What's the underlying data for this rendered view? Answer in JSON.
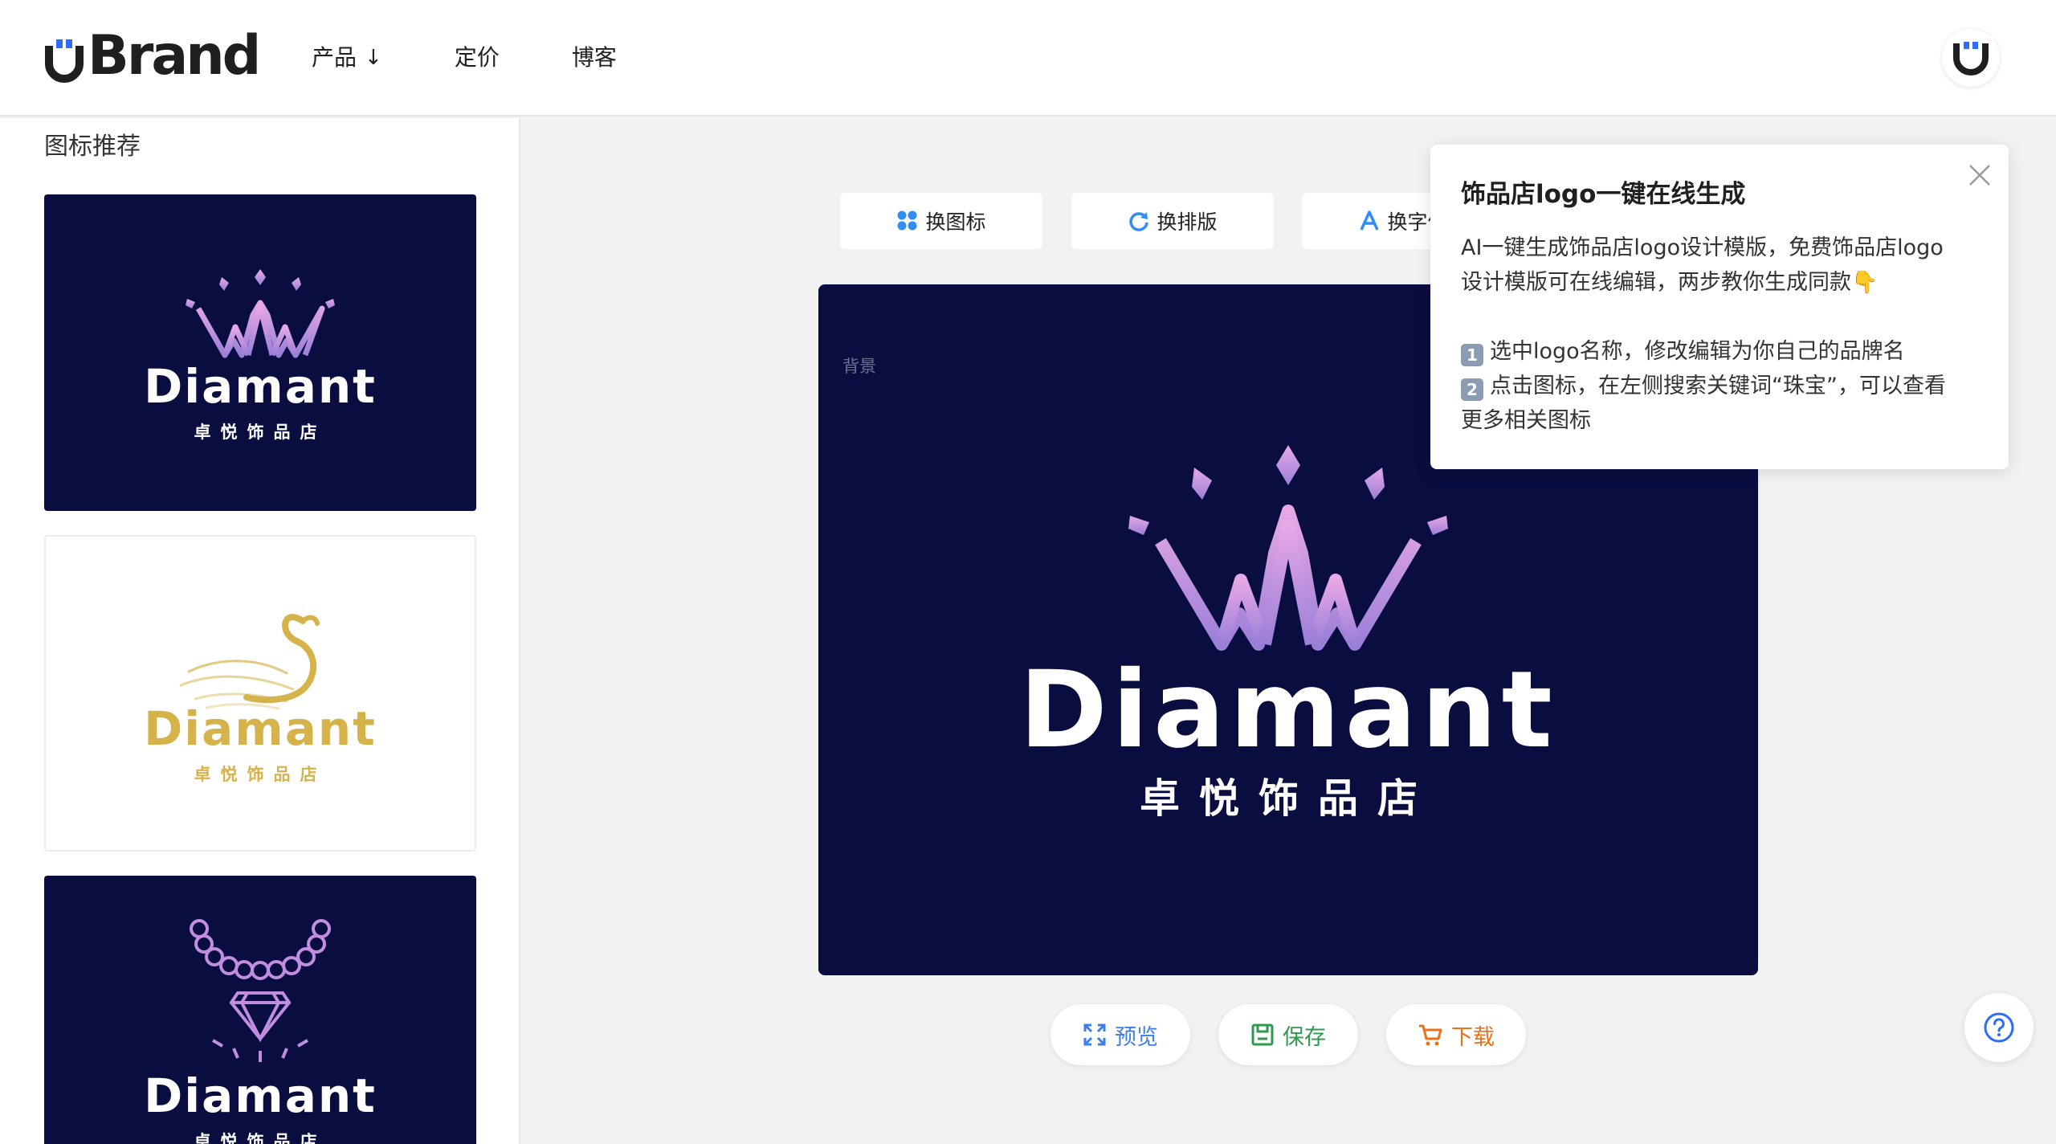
{
  "header": {
    "brand": "Brand",
    "nav": [
      {
        "label": "产品",
        "arrow": "↓"
      },
      {
        "label": "定价"
      },
      {
        "label": "博客"
      }
    ]
  },
  "sidebar": {
    "title": "图标推荐",
    "cards": [
      {
        "name": "Diamant",
        "sub": "卓悦饰品店",
        "bg": "#0a0d3f",
        "name_color": "#ffffff",
        "sub_color": "#ffffff",
        "icon": "crown-icon",
        "icon_color": "#c08de0"
      },
      {
        "name": "Diamant",
        "sub": "卓悦饰品店",
        "bg": "#ffffff",
        "name_color": "#d6b34a",
        "sub_color": "#d6b34a",
        "icon": "swan-icon",
        "icon_color": "#d6b34a"
      },
      {
        "name": "Diamant",
        "sub": "卓悦饰品店",
        "bg": "#0a0d3f",
        "name_color": "#ffffff",
        "sub_color": "#ffffff",
        "icon": "necklace-diamond-icon",
        "icon_color": "#c08de0"
      }
    ]
  },
  "toolbar": {
    "change_icon": "换图标",
    "change_layout": "换排版",
    "change_font": "换字体"
  },
  "canvas": {
    "bg_label": "背景",
    "name": "Diamant",
    "sub": "卓悦饰品店",
    "bg": "#0a0d3f",
    "icon": "crown-icon"
  },
  "actions": {
    "preview": "预览",
    "save": "保存",
    "download": "下载",
    "preview_color": "#3f7de8",
    "save_color": "#2e9a4f",
    "download_color": "#e8711c"
  },
  "popover": {
    "title": "饰品店logo一键在线生成",
    "desc_line1": "AI一键生成饰品店logo设计模版，免费饰品店logo",
    "desc_line2": "设计模版可在线编辑，两步教你生成同款👇",
    "step1_num": "1",
    "step1": "选中logo名称，修改编辑为你自己的品牌名",
    "step2_num": "2",
    "step2_a": "点击图标，在左侧搜索关键词“珠宝”，可以查看",
    "step2_b": "更多相关图标"
  },
  "colors": {
    "accent": "#2f6bff",
    "crown_light": "#e7a8e6",
    "crown_dark": "#9a7fd8"
  }
}
